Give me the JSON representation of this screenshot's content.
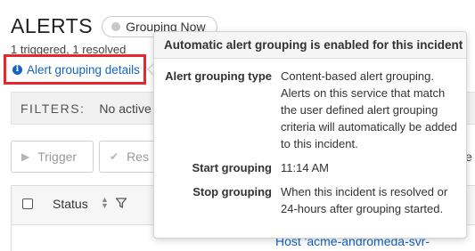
{
  "header": {
    "title": "ALERTS",
    "grouping_pill": "Grouping Now",
    "counts": "1 triggered, 1 resolved",
    "details_link": "Alert grouping details"
  },
  "filters": {
    "label": "FILTERS:",
    "value": "No active f"
  },
  "actions": {
    "trigger_label": "Trigger",
    "resolve_label": "Res",
    "right_fragment": "ze"
  },
  "table": {
    "status_header": "Status",
    "row_fragment": "Host 'acme-andromeda-svr-"
  },
  "popover": {
    "title": "Automatic alert grouping is enabled for this incident",
    "rows": [
      {
        "label": "Alert grouping type",
        "value": "Content-based alert grouping. Alerts on this service that match the user defined alert grouping criteria will automatically be added to this incident."
      },
      {
        "label": "Start grouping",
        "value": "11:14 AM"
      },
      {
        "label": "Stop grouping",
        "value": "When this incident is resolved or 24-hours after grouping started."
      }
    ]
  },
  "colors": {
    "link": "#1565c0",
    "highlight_border": "#e8262b",
    "pill_dot": "#c8c8c8"
  },
  "icons": {
    "info": "info-icon",
    "trigger": "play-icon",
    "resolve": "check-icon",
    "sort": "sort-icon",
    "filter": "filter-icon"
  }
}
